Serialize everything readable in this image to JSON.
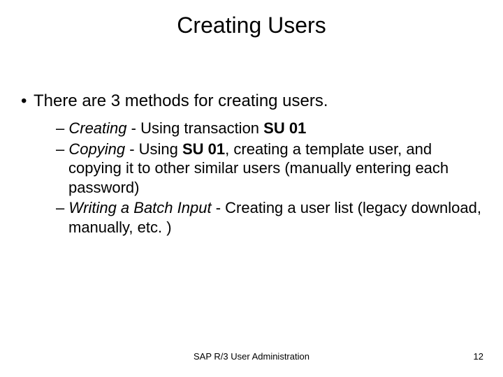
{
  "title": "Creating Users",
  "lvl1_text": "There are 3 methods for creating users.",
  "item1": {
    "em": "Creating",
    "rest1": " - Using transaction ",
    "bold": "SU 01"
  },
  "item2": {
    "em": "Copying",
    "rest1": " - Using ",
    "bold": "SU 01",
    "rest2": ", creating a template user, and copying it to other similar users (manually entering each password)"
  },
  "item3": {
    "em": "Writing a Batch Input",
    "rest1": " - Creating a user list (legacy download, manually, etc. )"
  },
  "footer_center": "SAP R/3 User Administration",
  "footer_right": "12"
}
